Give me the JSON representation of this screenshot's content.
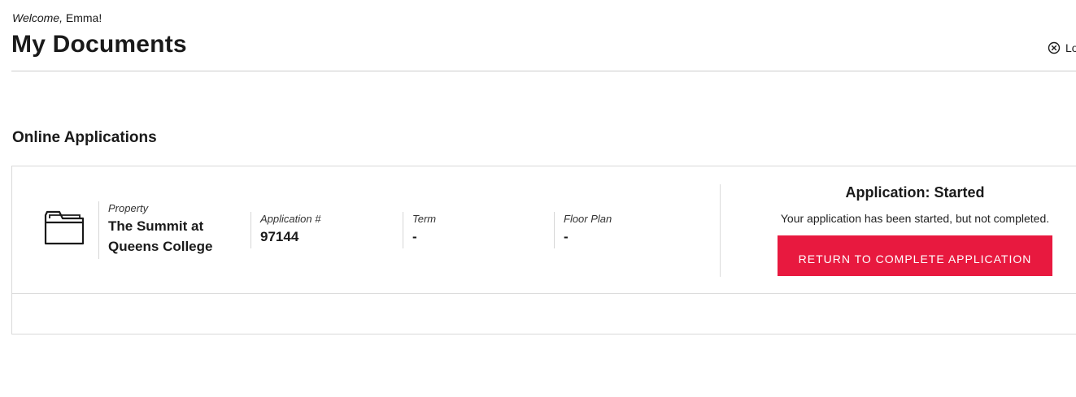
{
  "header": {
    "welcome_prefix": "Welcome,",
    "user_name": "Emma!",
    "title": "My Documents",
    "logout_label": "Lo"
  },
  "section": {
    "title": "Online Applications"
  },
  "application": {
    "property_label": "Property",
    "property_value": "The Summit at Queens College",
    "app_number_label": "Application #",
    "app_number_value": "97144",
    "term_label": "Term",
    "term_value": "-",
    "floor_plan_label": "Floor Plan",
    "floor_plan_value": "-",
    "status_title": "Application: Started",
    "status_text": "Your application has been started, but not completed.",
    "cta_label": "RETURN TO COMPLETE APPLICATION"
  },
  "icons": {
    "logout": "close-circle-icon",
    "folder": "folder-icon"
  },
  "colors": {
    "accent": "#e8193f",
    "text": "#1a1a1a",
    "border": "#d9d9d9"
  }
}
